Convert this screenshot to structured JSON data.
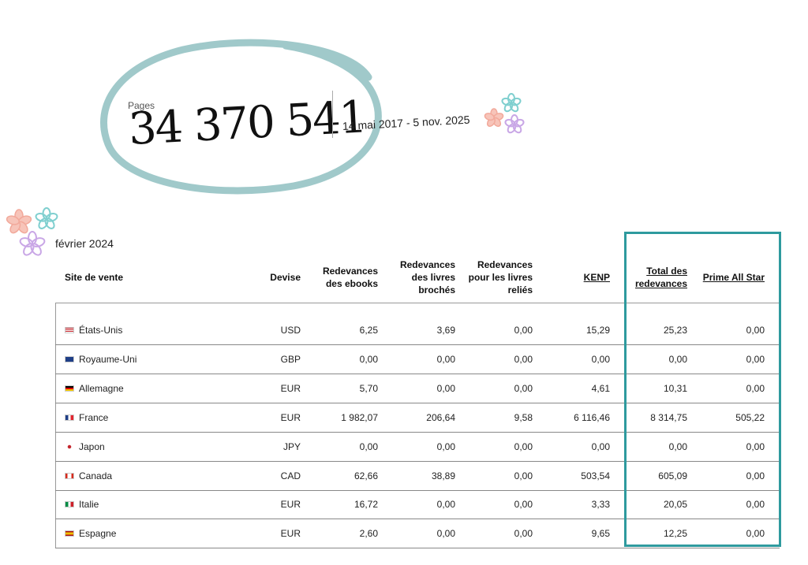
{
  "stats": {
    "pages_label": "Pages",
    "pages_value": "34 370 541",
    "date_range": "14 mai 2017 - 5 nov. 2025"
  },
  "month": "février 2024",
  "headers": {
    "site": "Site de vente",
    "currency": "Devise",
    "ebooks_line1": "Redevances",
    "ebooks_line2": "des ebooks",
    "paperback_line1": "Redevances",
    "paperback_line2": "des livres",
    "paperback_line3": "brochés",
    "hardcover_line1": "Redevances",
    "hardcover_line2": "pour les livres",
    "hardcover_line3": "reliés",
    "kenp": "KENP",
    "total_line1": "Total des",
    "total_line2": "redevances",
    "prime": "Prime All Star"
  },
  "rows": [
    {
      "site": "États-Unis",
      "flag": "us-flag-icon",
      "currency": "USD",
      "ebooks": "6,25",
      "paperback": "3,69",
      "hardcover": "0,00",
      "kenp": "15,29",
      "total": "25,23",
      "prime": "0,00"
    },
    {
      "site": "Royaume-Uni",
      "flag": "uk-flag-icon",
      "currency": "GBP",
      "ebooks": "0,00",
      "paperback": "0,00",
      "hardcover": "0,00",
      "kenp": "0,00",
      "total": "0,00",
      "prime": "0,00"
    },
    {
      "site": "Allemagne",
      "flag": "de-flag-icon",
      "currency": "EUR",
      "ebooks": "5,70",
      "paperback": "0,00",
      "hardcover": "0,00",
      "kenp": "4,61",
      "total": "10,31",
      "prime": "0,00"
    },
    {
      "site": "France",
      "flag": "fr-flag-icon",
      "currency": "EUR",
      "ebooks": "1 982,07",
      "paperback": "206,64",
      "hardcover": "9,58",
      "kenp": "6 116,46",
      "total": "8 314,75",
      "prime": "505,22"
    },
    {
      "site": "Japon",
      "flag": "jp-flag-icon",
      "currency": "JPY",
      "ebooks": "0,00",
      "paperback": "0,00",
      "hardcover": "0,00",
      "kenp": "0,00",
      "total": "0,00",
      "prime": "0,00"
    },
    {
      "site": "Canada",
      "flag": "ca-flag-icon",
      "currency": "CAD",
      "ebooks": "62,66",
      "paperback": "38,89",
      "hardcover": "0,00",
      "kenp": "503,54",
      "total": "605,09",
      "prime": "0,00"
    },
    {
      "site": "Italie",
      "flag": "it-flag-icon",
      "currency": "EUR",
      "ebooks": "16,72",
      "paperback": "0,00",
      "hardcover": "0,00",
      "kenp": "3,33",
      "total": "20,05",
      "prime": "0,00"
    },
    {
      "site": "Espagne",
      "flag": "es-flag-icon",
      "currency": "EUR",
      "ebooks": "2,60",
      "paperback": "0,00",
      "hardcover": "0,00",
      "kenp": "9,65",
      "total": "12,25",
      "prime": "0,00"
    }
  ],
  "colors": {
    "highlight": "#2e9a9e",
    "circle": "#8fc0c1",
    "flower_pink": "#f2a99b",
    "flower_teal": "#7fcfcf",
    "flower_purple": "#c9a7e6"
  }
}
